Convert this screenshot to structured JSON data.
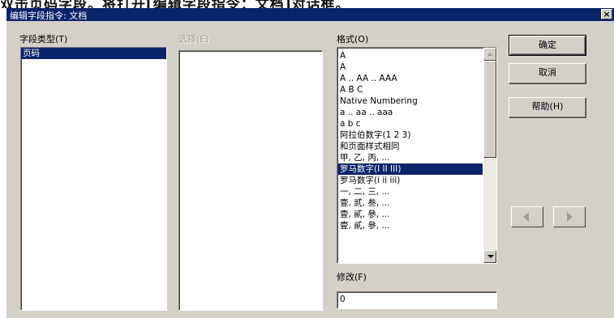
{
  "top_caption": "双击页码字段。将打开[编辑字段指令：文档]对话框。",
  "dialog": {
    "title": "编辑字段指令: 文档",
    "close_glyph": "×"
  },
  "field_type": {
    "label": "字段类型(T)",
    "items": [
      "页码"
    ],
    "selected_index": 0
  },
  "select": {
    "label": "选择(E)",
    "items": []
  },
  "format": {
    "label": "格式(O)",
    "items": [
      "A",
      "A",
      "A .. AA .. AAA",
      "A B C",
      "Native Numbering",
      "a .. aa .. aaa",
      "a b c",
      "阿拉伯数字(1 2 3)",
      "和页面样式相同",
      "甲, 乙, 丙, ...",
      "罗马数字(I II III)",
      "罗马数字(i ii iii)",
      "一, 二, 三, ...",
      "壹, 贰, 叁, ...",
      "壹, 貳, 參, ...",
      "壹, 貳, 參, ..."
    ],
    "selected_index": 10
  },
  "modify": {
    "label": "修改(F)",
    "value": "0"
  },
  "buttons": {
    "ok": "确定",
    "cancel": "取消",
    "help": "帮助(H)"
  },
  "icons": {
    "close": "close-icon",
    "scroll_up": "scroll-up-icon",
    "scroll_down": "scroll-down-icon",
    "prev": "arrow-left-icon",
    "next": "arrow-right-icon"
  },
  "colors": {
    "title_bar": "#0a246a",
    "dialog_bg": "#d4d0c8",
    "selection": "#0a246a"
  }
}
